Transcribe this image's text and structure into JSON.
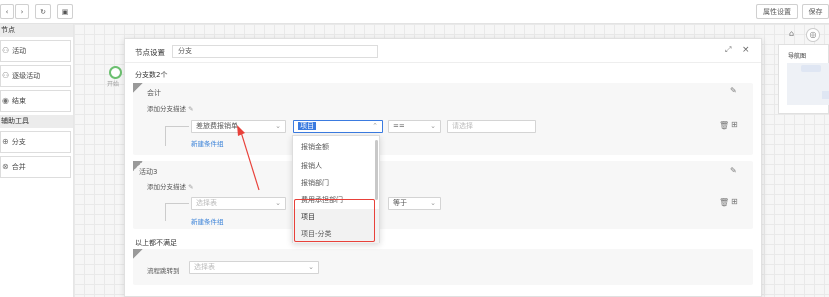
{
  "toolbar": {
    "back_icon": "chevron-left-icon",
    "forward_icon": "chevron-right-icon",
    "refresh_icon": "refresh-icon",
    "image_icon": "image-icon",
    "properties_label": "属性设置",
    "save_label": "保存"
  },
  "sidebar": {
    "section1_title": "节点",
    "items1": [
      {
        "label": "活动",
        "icon": "user-icon"
      },
      {
        "label": "逐级活动",
        "icon": "users-icon"
      },
      {
        "label": "结束",
        "icon": "stop-icon"
      }
    ],
    "section2_title": "辅助工具",
    "items2": [
      {
        "label": "分支",
        "icon": "branch-icon"
      },
      {
        "label": "合并",
        "icon": "merge-icon"
      }
    ]
  },
  "canvas": {
    "start_label": "开始"
  },
  "minimap": {
    "title": "导航图"
  },
  "dialog": {
    "title": "节点设置",
    "name_value": "分支",
    "branch_count_label": "分支数2个",
    "sections": [
      {
        "name": "会计",
        "add_desc_label": "添加分支描述",
        "field_value": "差旅费报销单",
        "field2_value": "项目",
        "operator_value": "==",
        "value_placeholder": "请选择",
        "new_group_label": "新建条件组"
      },
      {
        "name": "活动3",
        "add_desc_label": "添加分支描述",
        "field_placeholder": "选择表",
        "operator_value": "等于",
        "new_group_label": "新建条件组"
      }
    ],
    "fallback": {
      "title": "以上都不满足",
      "flow_label": "流程跳转到",
      "flow_placeholder": "选择表"
    },
    "dropdown_items": [
      "报销金额",
      "报销人",
      "报销部门",
      "费用承担部门",
      "项目",
      "项目-分类"
    ]
  },
  "colors": {
    "accent_red": "#e8413a",
    "link_blue": "#3a82d8",
    "selected_blue": "#3b7be0"
  }
}
